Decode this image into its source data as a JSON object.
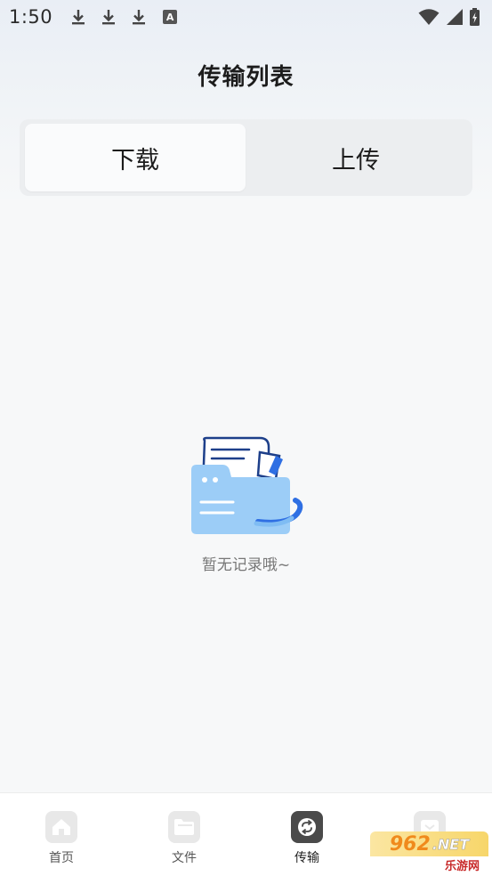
{
  "status_bar": {
    "time": "1:50",
    "a_icon_letter": "A"
  },
  "header": {
    "title": "传输列表"
  },
  "segmented": {
    "download_label": "下载",
    "upload_label": "上传",
    "selected": "download"
  },
  "empty_state": {
    "message": "暂无记录哦~"
  },
  "tab_bar": {
    "tabs": [
      {
        "label": "首页",
        "icon": "home-icon"
      },
      {
        "label": "文件",
        "icon": "folder-icon"
      },
      {
        "label": "传输",
        "icon": "transfer-icon",
        "active": true
      },
      {
        "label": "",
        "icon": "mine-icon"
      }
    ]
  },
  "watermark": {
    "brand": "962",
    "domain": ".NET",
    "site_name": "乐游网"
  },
  "colors": {
    "accent_blue": "#2f6fe3",
    "folder_light_blue": "#9ccdf7",
    "active_tab_icon": "#4a4a4a"
  }
}
